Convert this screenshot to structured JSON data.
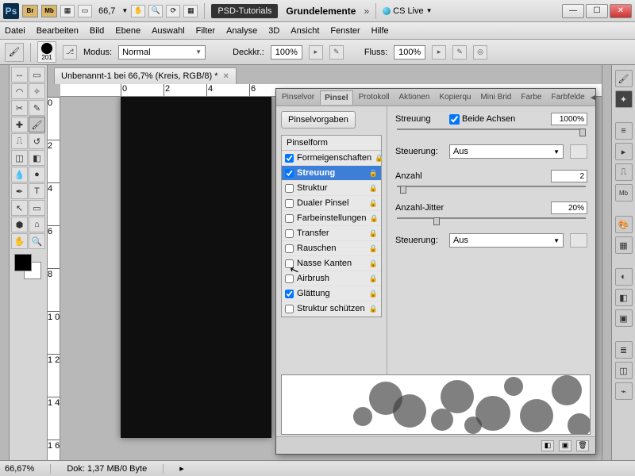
{
  "titlebar": {
    "ps": "Ps",
    "br": "Br",
    "mb": "Mb",
    "zoom": "66,7",
    "psd_tutorials": "PSD-Tutorials",
    "grundelemente": "Grundelemente",
    "cslive": "CS Live"
  },
  "menu": [
    "Datei",
    "Bearbeiten",
    "Bild",
    "Ebene",
    "Auswahl",
    "Filter",
    "Analyse",
    "3D",
    "Ansicht",
    "Fenster",
    "Hilfe"
  ],
  "options": {
    "brush_size": "201",
    "modus_label": "Modus:",
    "modus_value": "Normal",
    "deckkr_label": "Deckkr.:",
    "deckkr_value": "100%",
    "fluss_label": "Fluss:",
    "fluss_value": "100%"
  },
  "doc": {
    "tab": "Unbenannt-1 bei 66,7% (Kreis, RGB/8) *",
    "status_zoom": "66,67%",
    "status_doc": "Dok: 1,37 MB/0 Byte"
  },
  "panel": {
    "tabs": [
      "Pinselvor",
      "Pinsel",
      "Protokoll",
      "Aktionen",
      "Kopierqu",
      "Mini Brid",
      "Farbe",
      "Farbfelde"
    ],
    "active_tab": 1,
    "presets_btn": "Pinselvorgaben",
    "list_header": "Pinselform",
    "list": [
      {
        "label": "Formeigenschaften",
        "checked": true
      },
      {
        "label": "Streuung",
        "checked": true,
        "selected": true
      },
      {
        "label": "Struktur",
        "checked": false
      },
      {
        "label": "Dualer Pinsel",
        "checked": false
      },
      {
        "label": "Farbeinstellungen",
        "checked": false
      },
      {
        "label": "Transfer",
        "checked": false
      },
      {
        "label": "Rauschen",
        "checked": false
      },
      {
        "label": "Nasse Kanten",
        "checked": false
      },
      {
        "label": "Airbrush",
        "checked": false
      },
      {
        "label": "Glättung",
        "checked": true
      },
      {
        "label": "Struktur schützen",
        "checked": false
      }
    ],
    "streuung": {
      "label": "Streuung",
      "both_axes": "Beide Achsen",
      "both_axes_checked": true,
      "value": "1000%",
      "steuerung_label": "Steuerung:",
      "steuerung_value": "Aus",
      "anzahl_label": "Anzahl",
      "anzahl_value": "2",
      "jitter_label": "Anzahl-Jitter",
      "jitter_value": "20%",
      "steuerung2_value": "Aus"
    }
  },
  "ruler_h": [
    "0",
    "2",
    "4",
    "6"
  ],
  "ruler_v": [
    "0",
    "2",
    "4",
    "6",
    "8",
    "1 0",
    "1 2",
    "1 4",
    "1 6"
  ]
}
